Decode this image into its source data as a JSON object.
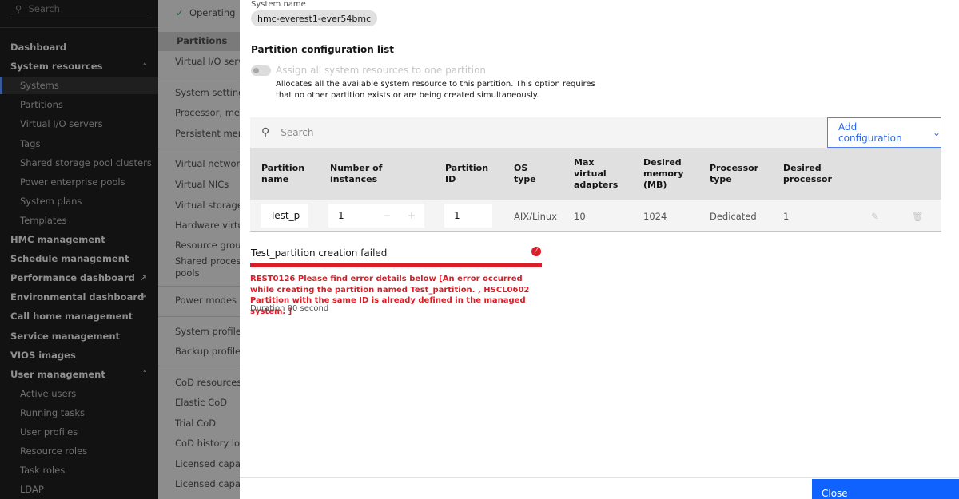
{
  "sidebar": {
    "search_placeholder": "Search",
    "items": [
      {
        "label": "Dashboard",
        "type": "head"
      },
      {
        "label": "System resources",
        "type": "head",
        "chevron": "^"
      },
      {
        "label": "Systems",
        "type": "sub",
        "active": true
      },
      {
        "label": "Partitions",
        "type": "sub"
      },
      {
        "label": "Virtual I/O servers",
        "type": "sub"
      },
      {
        "label": "Tags",
        "type": "sub"
      },
      {
        "label": "Shared storage pool clusters",
        "type": "sub"
      },
      {
        "label": "Power enterprise pools",
        "type": "sub"
      },
      {
        "label": "System plans",
        "type": "sub"
      },
      {
        "label": "Templates",
        "type": "sub"
      },
      {
        "label": "HMC management",
        "type": "head"
      },
      {
        "label": "Schedule management",
        "type": "head"
      },
      {
        "label": "Performance dashboard",
        "type": "head",
        "external": true
      },
      {
        "label": "Environmental dashboard",
        "type": "head",
        "external": true
      },
      {
        "label": "Call home management",
        "type": "head"
      },
      {
        "label": "Service management",
        "type": "head"
      },
      {
        "label": "VIOS images",
        "type": "head"
      },
      {
        "label": "User management",
        "type": "head",
        "chevron": "^"
      },
      {
        "label": "Active users",
        "type": "sub"
      },
      {
        "label": "Running tasks",
        "type": "sub"
      },
      {
        "label": "User profiles",
        "type": "sub"
      },
      {
        "label": "Resource roles",
        "type": "sub"
      },
      {
        "label": "Task roles",
        "type": "sub"
      },
      {
        "label": "LDAP",
        "type": "sub"
      }
    ]
  },
  "middle": {
    "status": "Operating",
    "selected": "Partitions",
    "items": [
      "Virtual I/O servers",
      "System settings",
      "Processor, memory",
      "Persistent memory",
      "Virtual networks",
      "Virtual NICs",
      "Virtual storage",
      "Hardware virtualized I/O",
      "Resource groups",
      "Shared processor",
      "pools",
      "Power modes",
      "System profiles",
      "Backup profile data",
      "CoD resources",
      "Elastic CoD",
      "Trial CoD",
      "CoD history log",
      "Licensed capabilities",
      "Licensed capabilities"
    ]
  },
  "modal": {
    "system_name_label": "System name",
    "system_name": "hmc-everest1-ever54bmc",
    "section_title": "Partition configuration list",
    "toggle_label": "Assign all system resources to one partition",
    "toggle_help": "Allocates all the available system resource to this partition. This option requires that no other partition exists or are being created simultaneously.",
    "search_placeholder": "Search",
    "add_button": "Add configuration",
    "columns": [
      "Partition name",
      "Number of instances",
      "Partition ID",
      "OS type",
      "Max virtual adapters",
      "Desired memory (MB)",
      "Processor type",
      "Desired processor"
    ],
    "row": {
      "name": "Test_p",
      "instances": "1",
      "partition_id": "1",
      "os_type": "AIX/Linux",
      "max_virtual_adapters": "10",
      "desired_memory": "1024",
      "processor_type": "Dedicated",
      "desired_processor": "1"
    },
    "error": {
      "title": "Test_partition creation failed",
      "message": "REST0126 Please find error details below [An error occurred while creating the partition named Test_partition. , HSCL0602 Partition with the same ID is already defined in the managed system. ]",
      "duration": "Duration 00 second",
      "progress": 1.0
    },
    "close_button": "Close"
  },
  "colors": {
    "primary": "#0f62fe",
    "error": "#da1e28"
  }
}
